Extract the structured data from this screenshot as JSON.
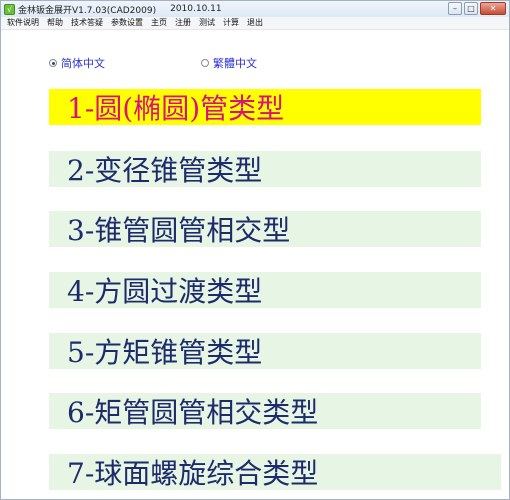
{
  "window": {
    "title": "金林钣金展开V1.7.03(CAD2009)",
    "date": "2010.10.11",
    "controls": {
      "minimize": "–",
      "maximize": "□",
      "close": "✕"
    },
    "icon": "app-icon"
  },
  "menu": [
    "软件说明",
    "帮助",
    "技术答疑",
    "参数设置",
    "主页",
    "注册",
    "测试",
    "计算",
    "退出"
  ],
  "language": {
    "simplified": {
      "label": "简体中文",
      "checked": true
    },
    "traditional": {
      "label": "繁體中文",
      "checked": false
    }
  },
  "types": [
    {
      "label": "1-圆(椭圆)管类型",
      "active": true
    },
    {
      "label": "2-变径锥管类型",
      "active": false
    },
    {
      "label": "3-锥管圆管相交型",
      "active": false
    },
    {
      "label": "4-方圆过渡类型",
      "active": false
    },
    {
      "label": "5-方矩锥管类型",
      "active": false
    },
    {
      "label": "6-矩管圆管相交类型",
      "active": false
    },
    {
      "label": "7-球面螺旋综合类型",
      "active": false
    }
  ],
  "colors": {
    "active_bg": "#ffff00",
    "active_text": "#d8127a",
    "button_bg": "#e7f6e4",
    "button_text": "#1e2a6b",
    "radio_text": "#2b33d0"
  }
}
